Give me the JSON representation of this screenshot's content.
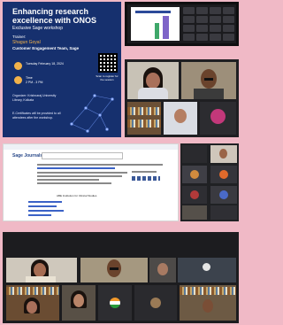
{
  "poster": {
    "title": "Enhancing research excellence with ONOS",
    "subtitle": "Exclusive Sage workshop",
    "trainer_label": "Trainer:",
    "trainer_name": "Shagun Goyal",
    "trainer_role": "Customer Engagement Team, Sage",
    "date": "Tuesday February 18, 2024",
    "time_label": "Time",
    "time": "2 PM - 3 PM",
    "qr_caption": "Scan to register for the session",
    "organizer": "Organizer: Krishnaraj University Library, Kolkata",
    "certificate": "E-Certificates will be provided to all attendees after the workshop."
  },
  "sage": {
    "logo": "Sage Journals",
    "heading": "ABE Institution for Clinical Studies"
  }
}
